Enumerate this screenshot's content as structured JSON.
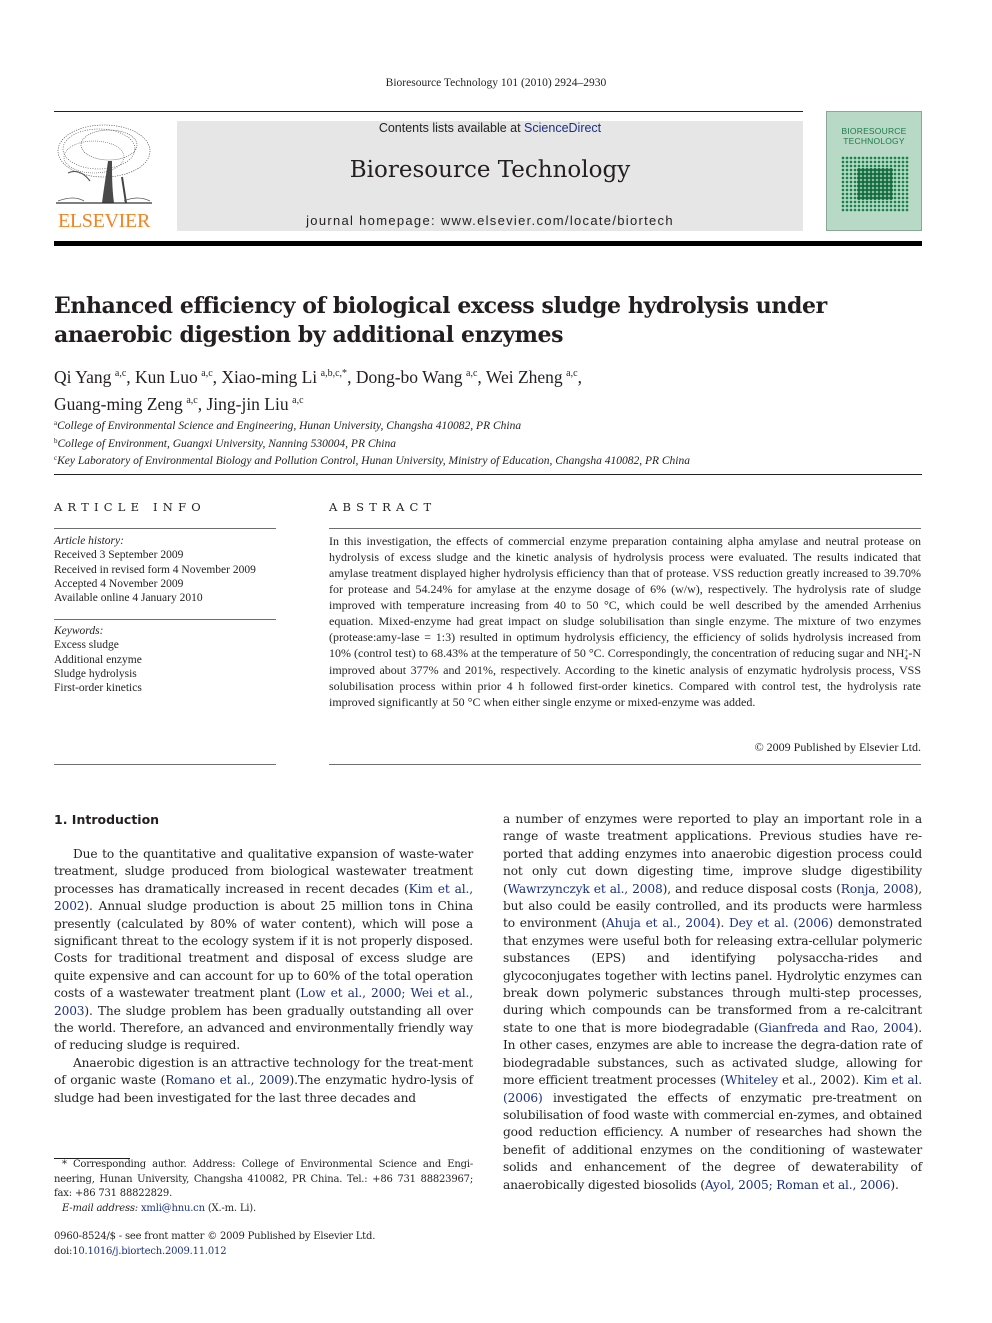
{
  "running_head": "Bioresource Technology 101 (2010) 2924–2930",
  "masthead": {
    "publisher_logo_text": "ELSEVIER",
    "contents_prefix": "Contents lists available at ",
    "contents_link": "ScienceDirect",
    "journal_name": "Bioresource Technology",
    "homepage_label": "journal homepage: ",
    "homepage_url": "www.elsevier.com/locate/biortech",
    "cover_title_line1": "BIORESOURCE",
    "cover_title_line2": "TECHNOLOGY",
    "colors": {
      "logo_orange": "#f58220",
      "link_blue": "#1a2f85",
      "cover_green": "#b7d9c5"
    }
  },
  "article": {
    "title": "Enhanced efficiency of biological excess sludge hydrolysis under anaerobic digestion by additional enzymes",
    "authors": [
      {
        "name": "Qi Yang",
        "affil": "a,c",
        "sep": ", "
      },
      {
        "name": "Kun Luo",
        "affil": "a,c",
        "sep": ", "
      },
      {
        "name": "Xiao-ming Li",
        "affil": "a,b,c,*",
        "sep": ", "
      },
      {
        "name": "Dong-bo Wang",
        "affil": "a,c",
        "sep": ", "
      },
      {
        "name": "Wei Zheng",
        "affil": "a,c",
        "sep": ","
      },
      {
        "name": "Guang-ming Zeng",
        "affil": "a,c",
        "sep": ", "
      },
      {
        "name": "Jing-jin Liu",
        "affil": "a,c",
        "sep": ""
      }
    ],
    "affiliations": [
      {
        "key": "a",
        "text": "College of Environmental Science and Engineering, Hunan University, Changsha 410082, PR China"
      },
      {
        "key": "b",
        "text": "College of Environment, Guangxi University, Nanning 530004, PR China"
      },
      {
        "key": "c",
        "text": "Key Laboratory of Environmental Biology and Pollution Control, Hunan University, Ministry of Education, Changsha 410082, PR China"
      }
    ]
  },
  "article_info": {
    "heading": "ARTICLE INFO",
    "history_label": "Article history:",
    "history": [
      "Received 3 September 2009",
      "Received in revised form 4 November 2009",
      "Accepted 4 November 2009",
      "Available online 4 January 2010"
    ],
    "keywords_label": "Keywords:",
    "keywords": [
      "Excess sludge",
      "Additional enzyme",
      "Sludge hydrolysis",
      "First-order kinetics"
    ]
  },
  "abstract": {
    "heading": "ABSTRACT",
    "text_part1": "In this investigation, the effects of commercial enzyme preparation containing alpha amylase and neutral protease on hydrolysis of excess sludge and the kinetic analysis of hydrolysis process were evaluated. The results indicated that amylase treatment displayed higher hydrolysis efficiency than that of protease. VSS reduction greatly increased to 39.70% for protease and 54.24% for amylase at the enzyme dosage of 6% (w/w), respectively. The hydrolysis rate of sludge improved with temperature increasing from 40 to 50 °C, which could be well described by the amended Arrhenius equation. Mixed-enzyme had great impact on sludge solubilisation than single enzyme. The mixture of two enzymes (protease:amy-­lase = 1:3) resulted in optimum hydrolysis efficiency, the efficiency of solids hydrolysis increased from 10% (control test) to 68.43% at the temperature of 50 °C. Correspondingly, the concentration of reducing sugar and NH",
    "nh4_sup": "+",
    "nh4_sub": "4",
    "text_part2": "-N improved about 377% and 201%, respectively. According to the kinetic analysis of enzymatic hydrolysis process, VSS solubilisation process within prior 4 h followed first-order kinetics. Compared with control test, the hydrolysis rate improved significantly at 50 °C when either single enzyme or mixed-enzyme was added.",
    "copyright": "© 2009 Published by Elsevier Ltd."
  },
  "body": {
    "section_heading": "1. Introduction",
    "left": {
      "p1": [
        {
          "t": "Due to the quantitative and qualitative expansion of waste-water treatment, sludge produced from biological wastewater treatment processes has dramatically increased in recent decades ("
        },
        {
          "link": "Kim et al., 2002"
        },
        {
          "t": "). Annual sludge production is about 25 million tons in China presently (calculated by 80% of water content), which will pose a significant threat to the ecology system if it is not properly disposed. Costs for traditional treatment and disposal of excess sludge are quite expensive and can account for up to 60% of the total operation costs of a wastewater treatment plant ("
        },
        {
          "link": "Low et al., 2000; Wei et al., 2003"
        },
        {
          "t": "). The sludge problem has been gradually outstanding all over the world. Therefore, an advanced and environmentally friendly way of reducing sludge is required."
        }
      ],
      "p2": [
        {
          "t": "Anaerobic digestion is an attractive technology for the treat-ment of organic waste ("
        },
        {
          "link": "Romano et al., 2009"
        },
        {
          "t": ").The enzymatic hydro-lysis of sludge had been investigated for the last three decades and"
        }
      ]
    },
    "right": {
      "p1": [
        {
          "t": "a number of enzymes were reported to play an important role in a range of waste treatment applications. Previous studies have re-ported that adding enzymes into anaerobic digestion process could not only cut down digesting time, improve sludge digestibility ("
        },
        {
          "link": "Wawrzynczyk et al., 2008"
        },
        {
          "t": "), and reduce disposal costs ("
        },
        {
          "link": "Ronja, 2008"
        },
        {
          "t": "), but also could be easily controlled, and its products were harmless to environment ("
        },
        {
          "link": "Ahuja et al., 2004"
        },
        {
          "t": "). "
        },
        {
          "link": "Dey et al. (2006)"
        },
        {
          "t": " demonstrated that enzymes were useful both for releasing extra-cellular polymeric substances (EPS) and identifying polysaccha-rides and glycoconjugates together with lectins panel. Hydrolytic enzymes can break down polymeric substances through multi-step processes, during which compounds can be transformed from a re-calcitrant state to one that is more biodegradable ("
        },
        {
          "link": "Gianfreda and Rao, 2004"
        },
        {
          "t": "). In other cases, enzymes are able to increase the degra-dation rate of biodegradable substances, such as activated sludge, allowing for more efficient treatment processes ("
        },
        {
          "link": "Whiteley"
        },
        {
          "t": " et al., 2002). "
        },
        {
          "link": "Kim et al. (2006)"
        },
        {
          "t": " investigated the effects of enzymatic pre-treatment on solubilisation of food waste with commercial en-zymes, and obtained good reduction efficiency. A number of researches had shown the benefit of additional enzymes on the conditioning of wastewater solids and enhancement of the degree of dewaterability of anaerobically digested biosolids ("
        },
        {
          "link": "Ayol, 2005; Roman et al., 2006"
        },
        {
          "t": ")."
        }
      ]
    }
  },
  "footnote": {
    "corresponding": "* Corresponding author. Address: College of Environmental Science and Engi-neering, Hunan University, Changsha 410082, PR China. Tel.: +86 731 88823967; fax: +86 731 88822829.",
    "email_label": "E-mail address:",
    "email": "xmli@hnu.cn",
    "email_suffix": " (X.-m. Li).",
    "front_matter": "0960-8524/$ - see front matter © 2009 Published by Elsevier Ltd.",
    "doi_label": "doi:",
    "doi": "10.1016/j.biortech.2009.11.012"
  }
}
